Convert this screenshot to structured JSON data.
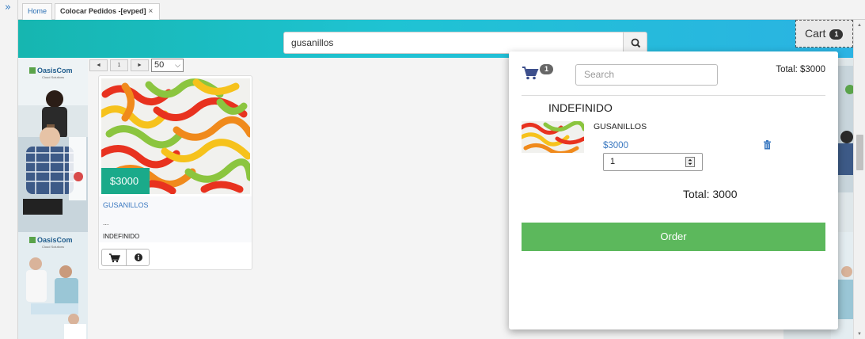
{
  "sidebar": {
    "collapse_icon": "double-chevron-right-icon",
    "collapse_glyph": "»"
  },
  "tabs": [
    {
      "label": "Home"
    },
    {
      "label": "Colocar Pedidos -[evped]",
      "close": "×"
    }
  ],
  "header": {
    "search_value": "gusanillos",
    "search_icon": "search-icon",
    "cart_label": "Cart",
    "cart_count": "1"
  },
  "ads": {
    "brand": "OasisCom",
    "tagline": "Cloud Solutions"
  },
  "pager": {
    "prev": "◄",
    "page": "1",
    "next": "►",
    "page_size": "50",
    "page_size_arrow": "⌵"
  },
  "product": {
    "price": "$3000",
    "name": "GUSANILLOS",
    "description": "...",
    "category": "INDEFINIDO",
    "actions": [
      "cart-icon",
      "info-icon"
    ]
  },
  "cart_panel": {
    "count": "1",
    "search_placeholder": "Search",
    "total_top": "Total: $3000",
    "category": "INDEFINIDO",
    "item": {
      "name": "GUSANILLOS",
      "price": "$3000",
      "quantity": "1"
    },
    "total_bottom": "Total: 3000",
    "order_label": "Order"
  },
  "colors": {
    "header_gradient": [
      "#16b6b0",
      "#2bb3e3"
    ],
    "price_tag": "#1aaa8a",
    "order_button": "#5cb85c",
    "link": "#3a78c0"
  }
}
